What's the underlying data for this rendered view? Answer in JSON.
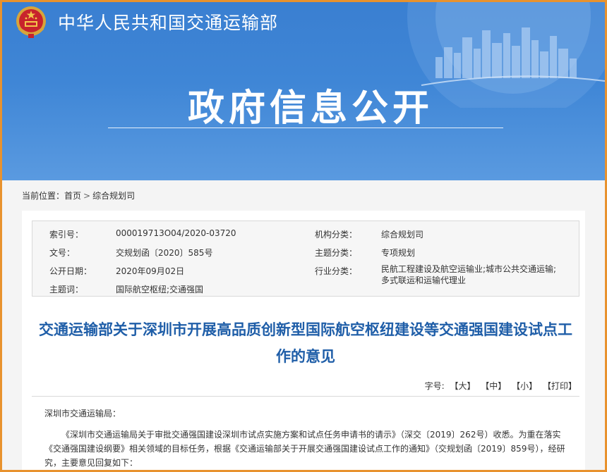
{
  "header": {
    "site_name": "中华人民共和国交通运输部",
    "banner_title": "政府信息公开"
  },
  "breadcrumb": {
    "label": "当前位置：",
    "home": "首页",
    "separator": ">",
    "current": "综合规划司"
  },
  "meta": {
    "index_label": "索引号：",
    "index_value": "000019713O04/2020-03720",
    "org_label": "机构分类：",
    "org_value": "综合规划司",
    "docno_label": "文号：",
    "docno_value": "交规划函〔2020〕585号",
    "topic_label": "主题分类：",
    "topic_value": "专项规划",
    "date_label": "公开日期：",
    "date_value": "2020年09月02日",
    "industry_label": "行业分类：",
    "industry_value": "民航工程建设及航空运输业;城市公共交通运输;多式联运和运输代理业",
    "keyword_label": "主题词：",
    "keyword_value": "国际航空枢纽;交通强国"
  },
  "article": {
    "title": "交通运输部关于深圳市开展高品质创新型国际航空枢纽建设等交通强国建设试点工作的意见",
    "font_size_label": "字号:",
    "font_large": "【大】",
    "font_medium": "【中】",
    "font_small": "【小】",
    "print": "【打印】",
    "salutation": "深圳市交通运输局：",
    "paragraph_1": "《深圳市交通运输局关于审批交通强国建设深圳市试点实施方案和试点任务申请书的请示》（深交〔2019〕262号）收悉。为重在落实《交通强国建设纲要》相关领域的目标任务，根据《交通运输部关于开展交通强国建设试点工作的通知》（交规划函〔2019〕859号），经研究，主要意见回复如下："
  },
  "colors": {
    "banner_blue": "#3f86d6",
    "title_blue": "#1f5ea8",
    "frame_orange": "#e8922e"
  }
}
